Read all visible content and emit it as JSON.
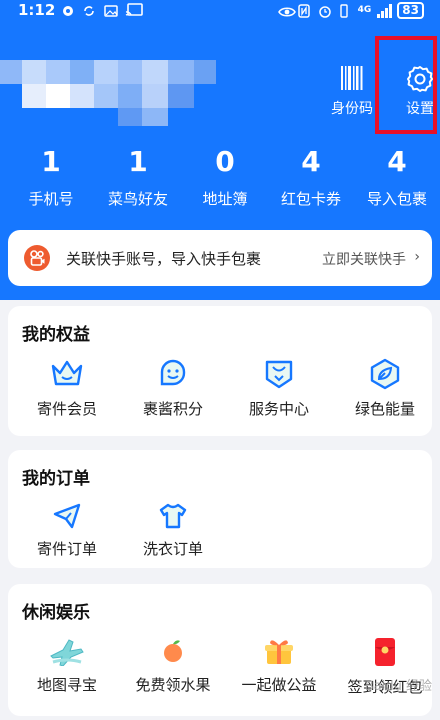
{
  "status_bar": {
    "time": "1:12",
    "network": "4G",
    "battery": "83"
  },
  "header": {
    "code_label": "身份码",
    "settings_label": "设置"
  },
  "stats": [
    {
      "value": "1",
      "label": "手机号"
    },
    {
      "value": "1",
      "label": "菜鸟好友"
    },
    {
      "value": "0",
      "label": "地址簿"
    },
    {
      "value": "4",
      "label": "红包卡券"
    },
    {
      "value": "4",
      "label": "导入包裹"
    }
  ],
  "banner": {
    "text": "关联快手账号，导入快手包裹",
    "link": "立即关联快手",
    "chevron": "›"
  },
  "rights": {
    "title": "我的权益",
    "items": [
      {
        "label": "寄件会员",
        "icon": "crown-icon"
      },
      {
        "label": "裹酱积分",
        "icon": "smile-face-icon"
      },
      {
        "label": "服务中心",
        "icon": "service-bot-icon"
      },
      {
        "label": "绿色能量",
        "icon": "leaf-icon"
      }
    ]
  },
  "orders": {
    "title": "我的订单",
    "items": [
      {
        "label": "寄件订单",
        "icon": "send-plane-icon"
      },
      {
        "label": "洗衣订单",
        "icon": "tshirt-icon"
      }
    ]
  },
  "leisure": {
    "title": "休闲娱乐",
    "items": [
      {
        "label": "地图寻宝",
        "icon": "map-plane-icon"
      },
      {
        "label": "免费领水果",
        "icon": "fruit-icon"
      },
      {
        "label": "一起做公益",
        "icon": "gift-box-icon"
      },
      {
        "label": "签到领红包",
        "icon": "red-envelope-icon"
      }
    ]
  },
  "watermark": "Baidu 经验",
  "colors": {
    "brand_blue": "#1677ff",
    "highlight_red": "#e8102a",
    "kuaishou_orange": "#ee5b2f"
  }
}
